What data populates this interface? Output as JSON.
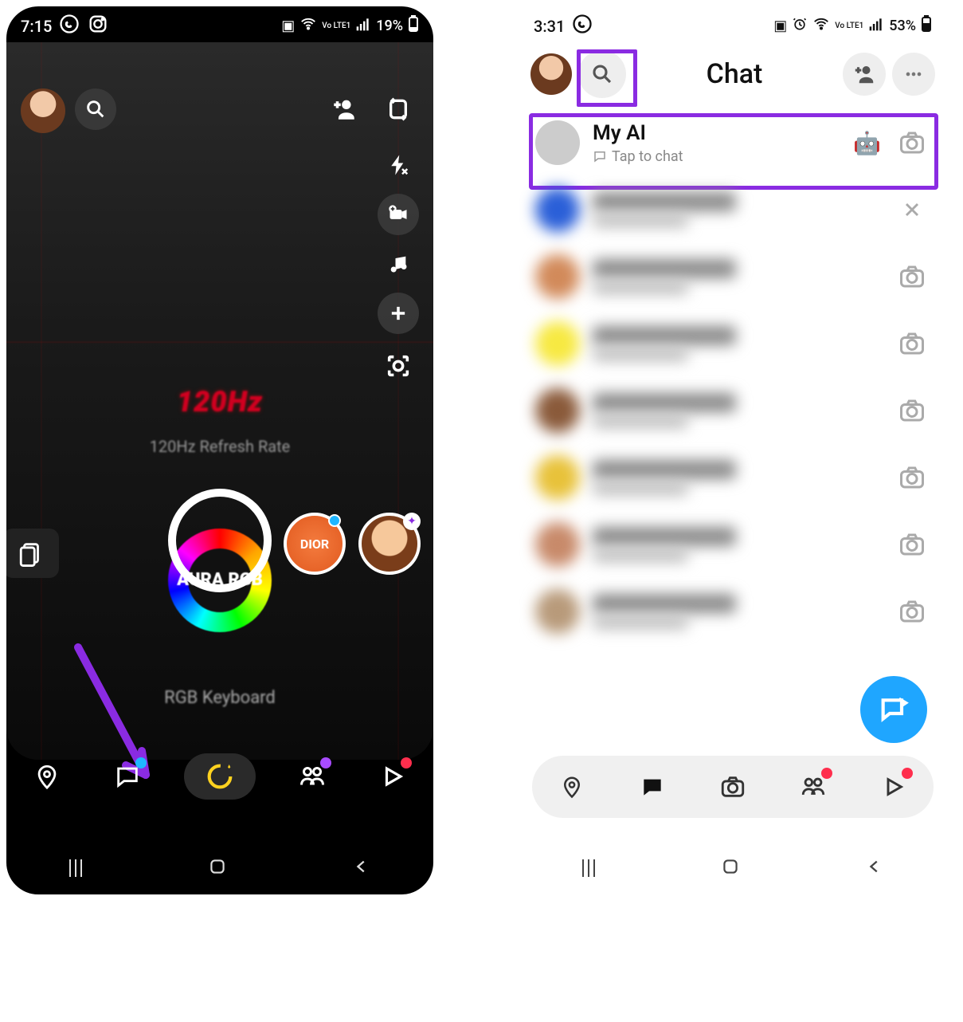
{
  "left": {
    "status": {
      "time": "7:15",
      "apps": [
        "whatsapp",
        "instagram"
      ],
      "battery_pct": "19%",
      "net": "Vo LTE1"
    },
    "camera": {
      "bg_text_hz": "120Hz",
      "bg_text_rate": "120Hz Refresh Rate",
      "bg_text_aura": "AURA\nRGB",
      "bg_text_kb": "RGB Keyboard"
    },
    "lenses": {
      "a": "DIOR"
    },
    "nav": [
      "map",
      "chat",
      "snap",
      "stories",
      "spotlight"
    ]
  },
  "right": {
    "status": {
      "time": "3:31",
      "apps": [
        "whatsapp"
      ],
      "battery_pct": "53%",
      "net": "Vo LTE1"
    },
    "header": {
      "title": "Chat"
    },
    "myai": {
      "name": "My AI",
      "subtitle": "Tap to chat",
      "robot": "🤖"
    },
    "blurred_rows": 7,
    "nav": [
      "map",
      "chat",
      "snap",
      "stories",
      "spotlight"
    ]
  }
}
